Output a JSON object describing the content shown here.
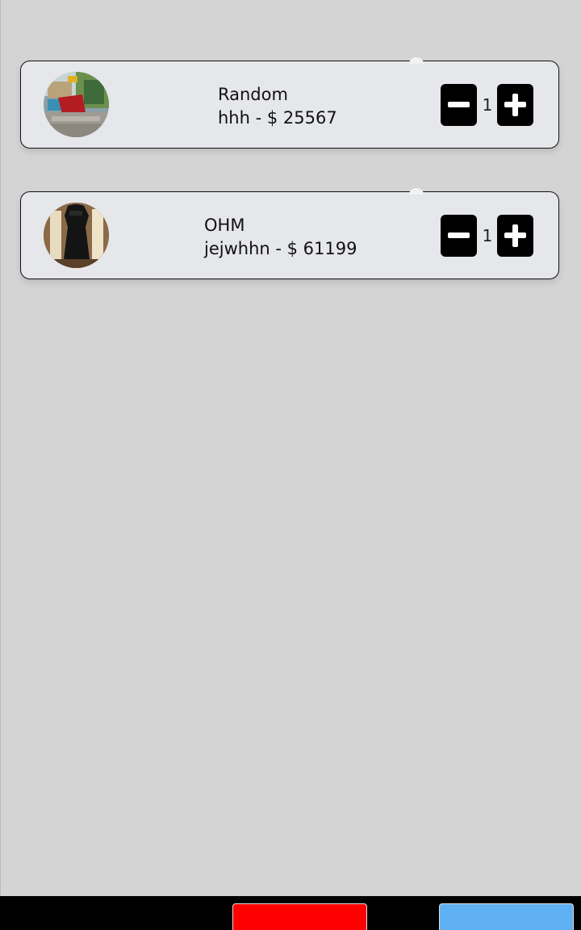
{
  "cart": {
    "items": [
      {
        "name": "Random",
        "detail": "hhh - $ 25567",
        "quantity": "1",
        "image": "street-scene-photo"
      },
      {
        "name": "OHM",
        "detail": "jejwhhn - $ 61199",
        "quantity": "1",
        "image": "black-dress-photo"
      }
    ]
  },
  "bottom_bar": {
    "left_button": {
      "label": "",
      "color": "#ff0000"
    },
    "right_button": {
      "label": "",
      "color": "#60b0f4"
    }
  },
  "colors": {
    "background": "#d4d4d4",
    "card": "#e6e7ea",
    "button": "#000000"
  }
}
